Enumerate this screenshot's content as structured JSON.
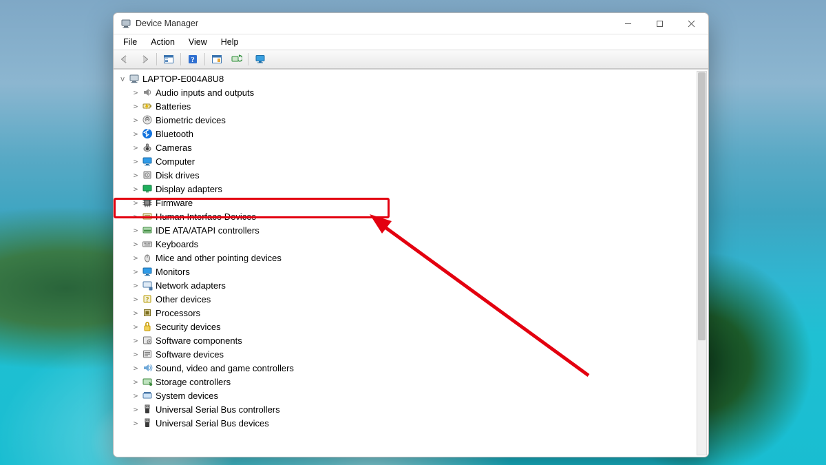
{
  "window": {
    "title": "Device Manager"
  },
  "menu": {
    "file": "File",
    "action": "Action",
    "view": "View",
    "help": "Help"
  },
  "tree": {
    "root": "LAPTOP-E004A8U8",
    "nodes": [
      {
        "label": "Audio inputs and outputs",
        "icon": "speaker"
      },
      {
        "label": "Batteries",
        "icon": "battery"
      },
      {
        "label": "Biometric devices",
        "icon": "fingerprint"
      },
      {
        "label": "Bluetooth",
        "icon": "bluetooth"
      },
      {
        "label": "Cameras",
        "icon": "camera"
      },
      {
        "label": "Computer",
        "icon": "monitor"
      },
      {
        "label": "Disk drives",
        "icon": "disk"
      },
      {
        "label": "Display adapters",
        "icon": "display"
      },
      {
        "label": "Firmware",
        "icon": "chip"
      },
      {
        "label": "Human Interface Devices",
        "icon": "hid"
      },
      {
        "label": "IDE ATA/ATAPI controllers",
        "icon": "ide"
      },
      {
        "label": "Keyboards",
        "icon": "keyboard"
      },
      {
        "label": "Mice and other pointing devices",
        "icon": "mouse"
      },
      {
        "label": "Monitors",
        "icon": "monitor"
      },
      {
        "label": "Network adapters",
        "icon": "network"
      },
      {
        "label": "Other devices",
        "icon": "other"
      },
      {
        "label": "Processors",
        "icon": "cpu"
      },
      {
        "label": "Security devices",
        "icon": "security"
      },
      {
        "label": "Software components",
        "icon": "swcomp"
      },
      {
        "label": "Software devices",
        "icon": "swdev"
      },
      {
        "label": "Sound, video and game controllers",
        "icon": "sound"
      },
      {
        "label": "Storage controllers",
        "icon": "storage"
      },
      {
        "label": "System devices",
        "icon": "system"
      },
      {
        "label": "Universal Serial Bus controllers",
        "icon": "usb"
      },
      {
        "label": "Universal Serial Bus devices",
        "icon": "usb"
      }
    ]
  },
  "annotation": {
    "highlightedIndex": 4
  }
}
